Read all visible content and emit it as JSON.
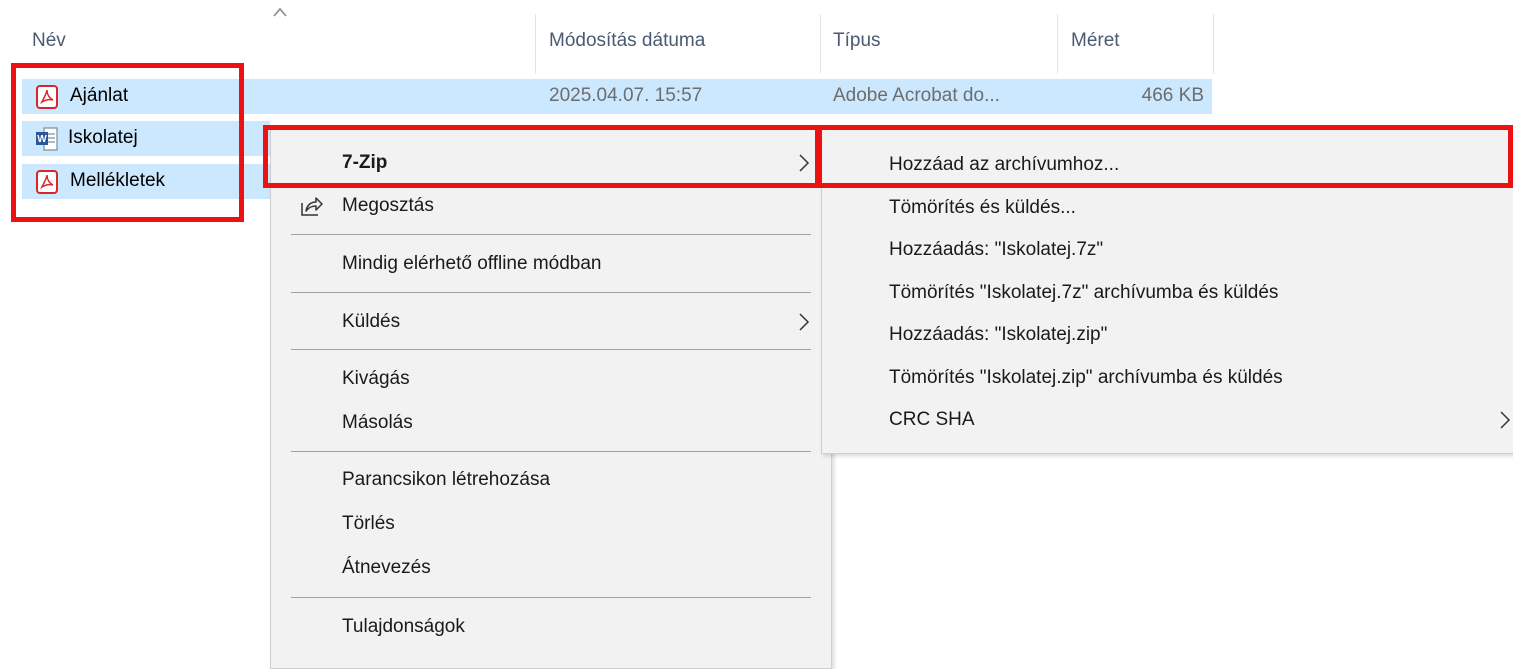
{
  "columns": {
    "name": "Név",
    "modified": "Módosítás dátuma",
    "type": "Típus",
    "size": "Méret"
  },
  "files": [
    {
      "name": "Ajánlat",
      "icon": "pdf-icon",
      "modified": "2025.04.07. 15:57",
      "type": "Adobe Acrobat do...",
      "size": "466 KB"
    },
    {
      "name": "Iskolatej",
      "icon": "word-document-icon"
    },
    {
      "name": "Mellékletek",
      "icon": "pdf-icon"
    }
  ],
  "context_menu": {
    "items": [
      {
        "label": "7-Zip",
        "submenu": true
      },
      {
        "label": "Megosztás",
        "icon": "share-icon"
      },
      {
        "label": "Mindig elérhető offline módban"
      },
      {
        "label": "Küldés",
        "submenu": true
      },
      {
        "label": "Kivágás"
      },
      {
        "label": "Másolás"
      },
      {
        "label": "Parancsikon létrehozása"
      },
      {
        "label": "Törlés"
      },
      {
        "label": "Átnevezés"
      },
      {
        "label": "Tulajdonságok"
      }
    ]
  },
  "submenu_7zip": {
    "items": [
      {
        "label": "Hozzáad az archívumhoz..."
      },
      {
        "label": "Tömörítés és küldés..."
      },
      {
        "label": "Hozzáadás: \"Iskolatej.7z\""
      },
      {
        "label": "Tömörítés \"Iskolatej.7z\" archívumba és küldés"
      },
      {
        "label": "Hozzáadás: \"Iskolatej.zip\""
      },
      {
        "label": "Tömörítés \"Iskolatej.zip\" archívumba és küldés"
      },
      {
        "label": "CRC SHA",
        "submenu": true
      }
    ]
  },
  "colors": {
    "selection": "#cce8ff",
    "menu_bg": "#f2f2f2",
    "highlight_red": "#ee1111",
    "pdf_red": "#d9262a",
    "word_blue": "#2b579a"
  }
}
